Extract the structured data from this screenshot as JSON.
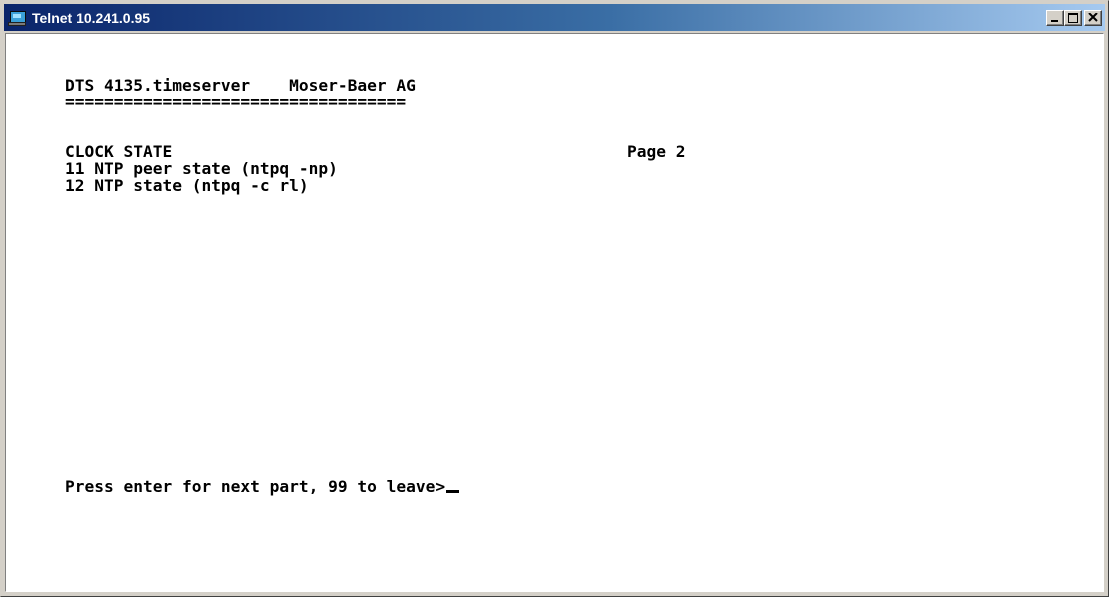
{
  "window": {
    "title": "Telnet 10.241.0.95"
  },
  "terminal": {
    "header": "DTS 4135.timeserver    Moser-Baer AG",
    "separator": "===================================",
    "section_title": "CLOCK STATE",
    "page_label": "Page 2",
    "menu_items": [
      "11 NTP peer state (ntpq -np)",
      "12 NTP state (ntpq -c rl)"
    ],
    "prompt": "Press enter for next part, 99 to leave>"
  },
  "icons": {
    "app": "telnet-app-icon",
    "minimize": "minimize-icon",
    "maximize": "maximize-icon",
    "close": "close-icon"
  }
}
